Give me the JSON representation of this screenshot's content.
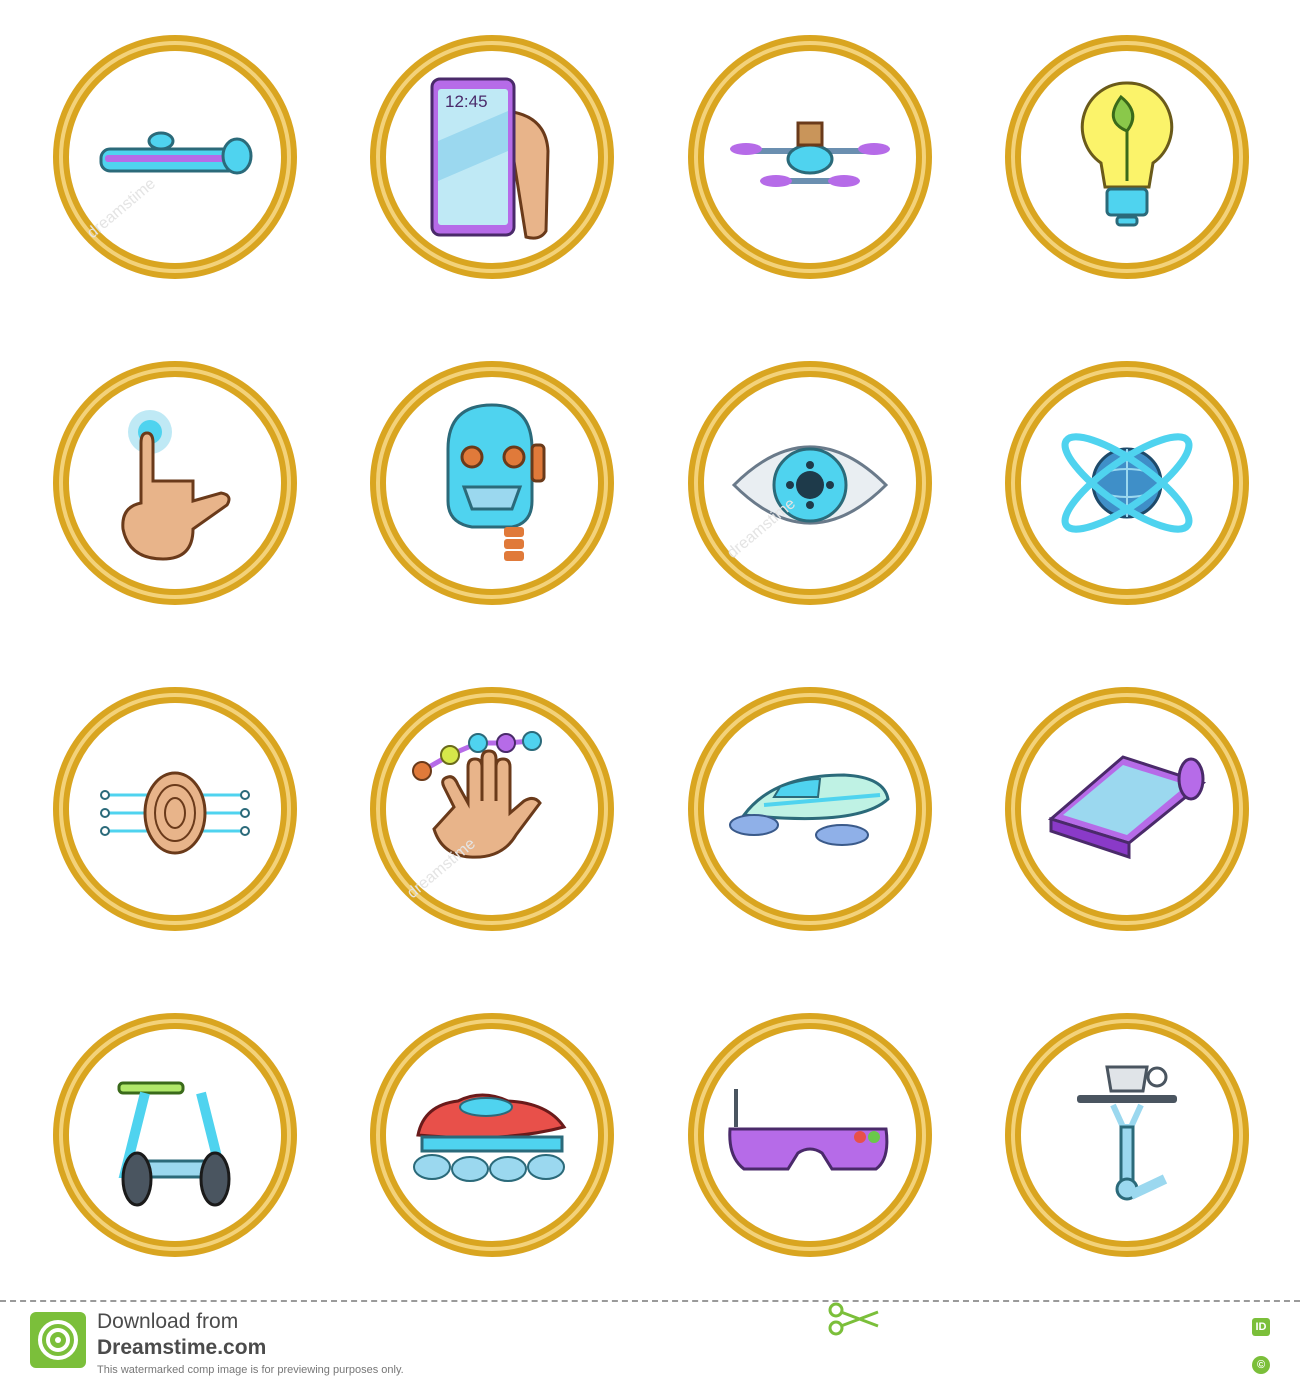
{
  "icons": {
    "phone_time": "12:45",
    "names": [
      "headband-icon",
      "smartphone-icon",
      "drone-icon",
      "eco-bulb-icon",
      "touch-finger-icon",
      "robot-head-icon",
      "cyber-eye-icon",
      "globe-orbit-icon",
      "fingerprint-icon",
      "hand-molecule-icon",
      "maglev-train-icon",
      "flexible-tablet-icon",
      "segway-icon",
      "hover-car-icon",
      "vr-goggles-icon",
      "robot-arm-icon"
    ]
  },
  "colors": {
    "ring_gold": "#d9a520",
    "ring_light": "#f3d27a",
    "accent_cyan": "#4fd3ef",
    "accent_purple": "#b66be8",
    "skin": "#e8b48a"
  },
  "footer": {
    "line1": "Download from",
    "line2": "Dreamstime.com",
    "note": "This watermarked comp image is for previewing purposes only.",
    "id_badge": "ID",
    "copyright_badge": "©"
  }
}
